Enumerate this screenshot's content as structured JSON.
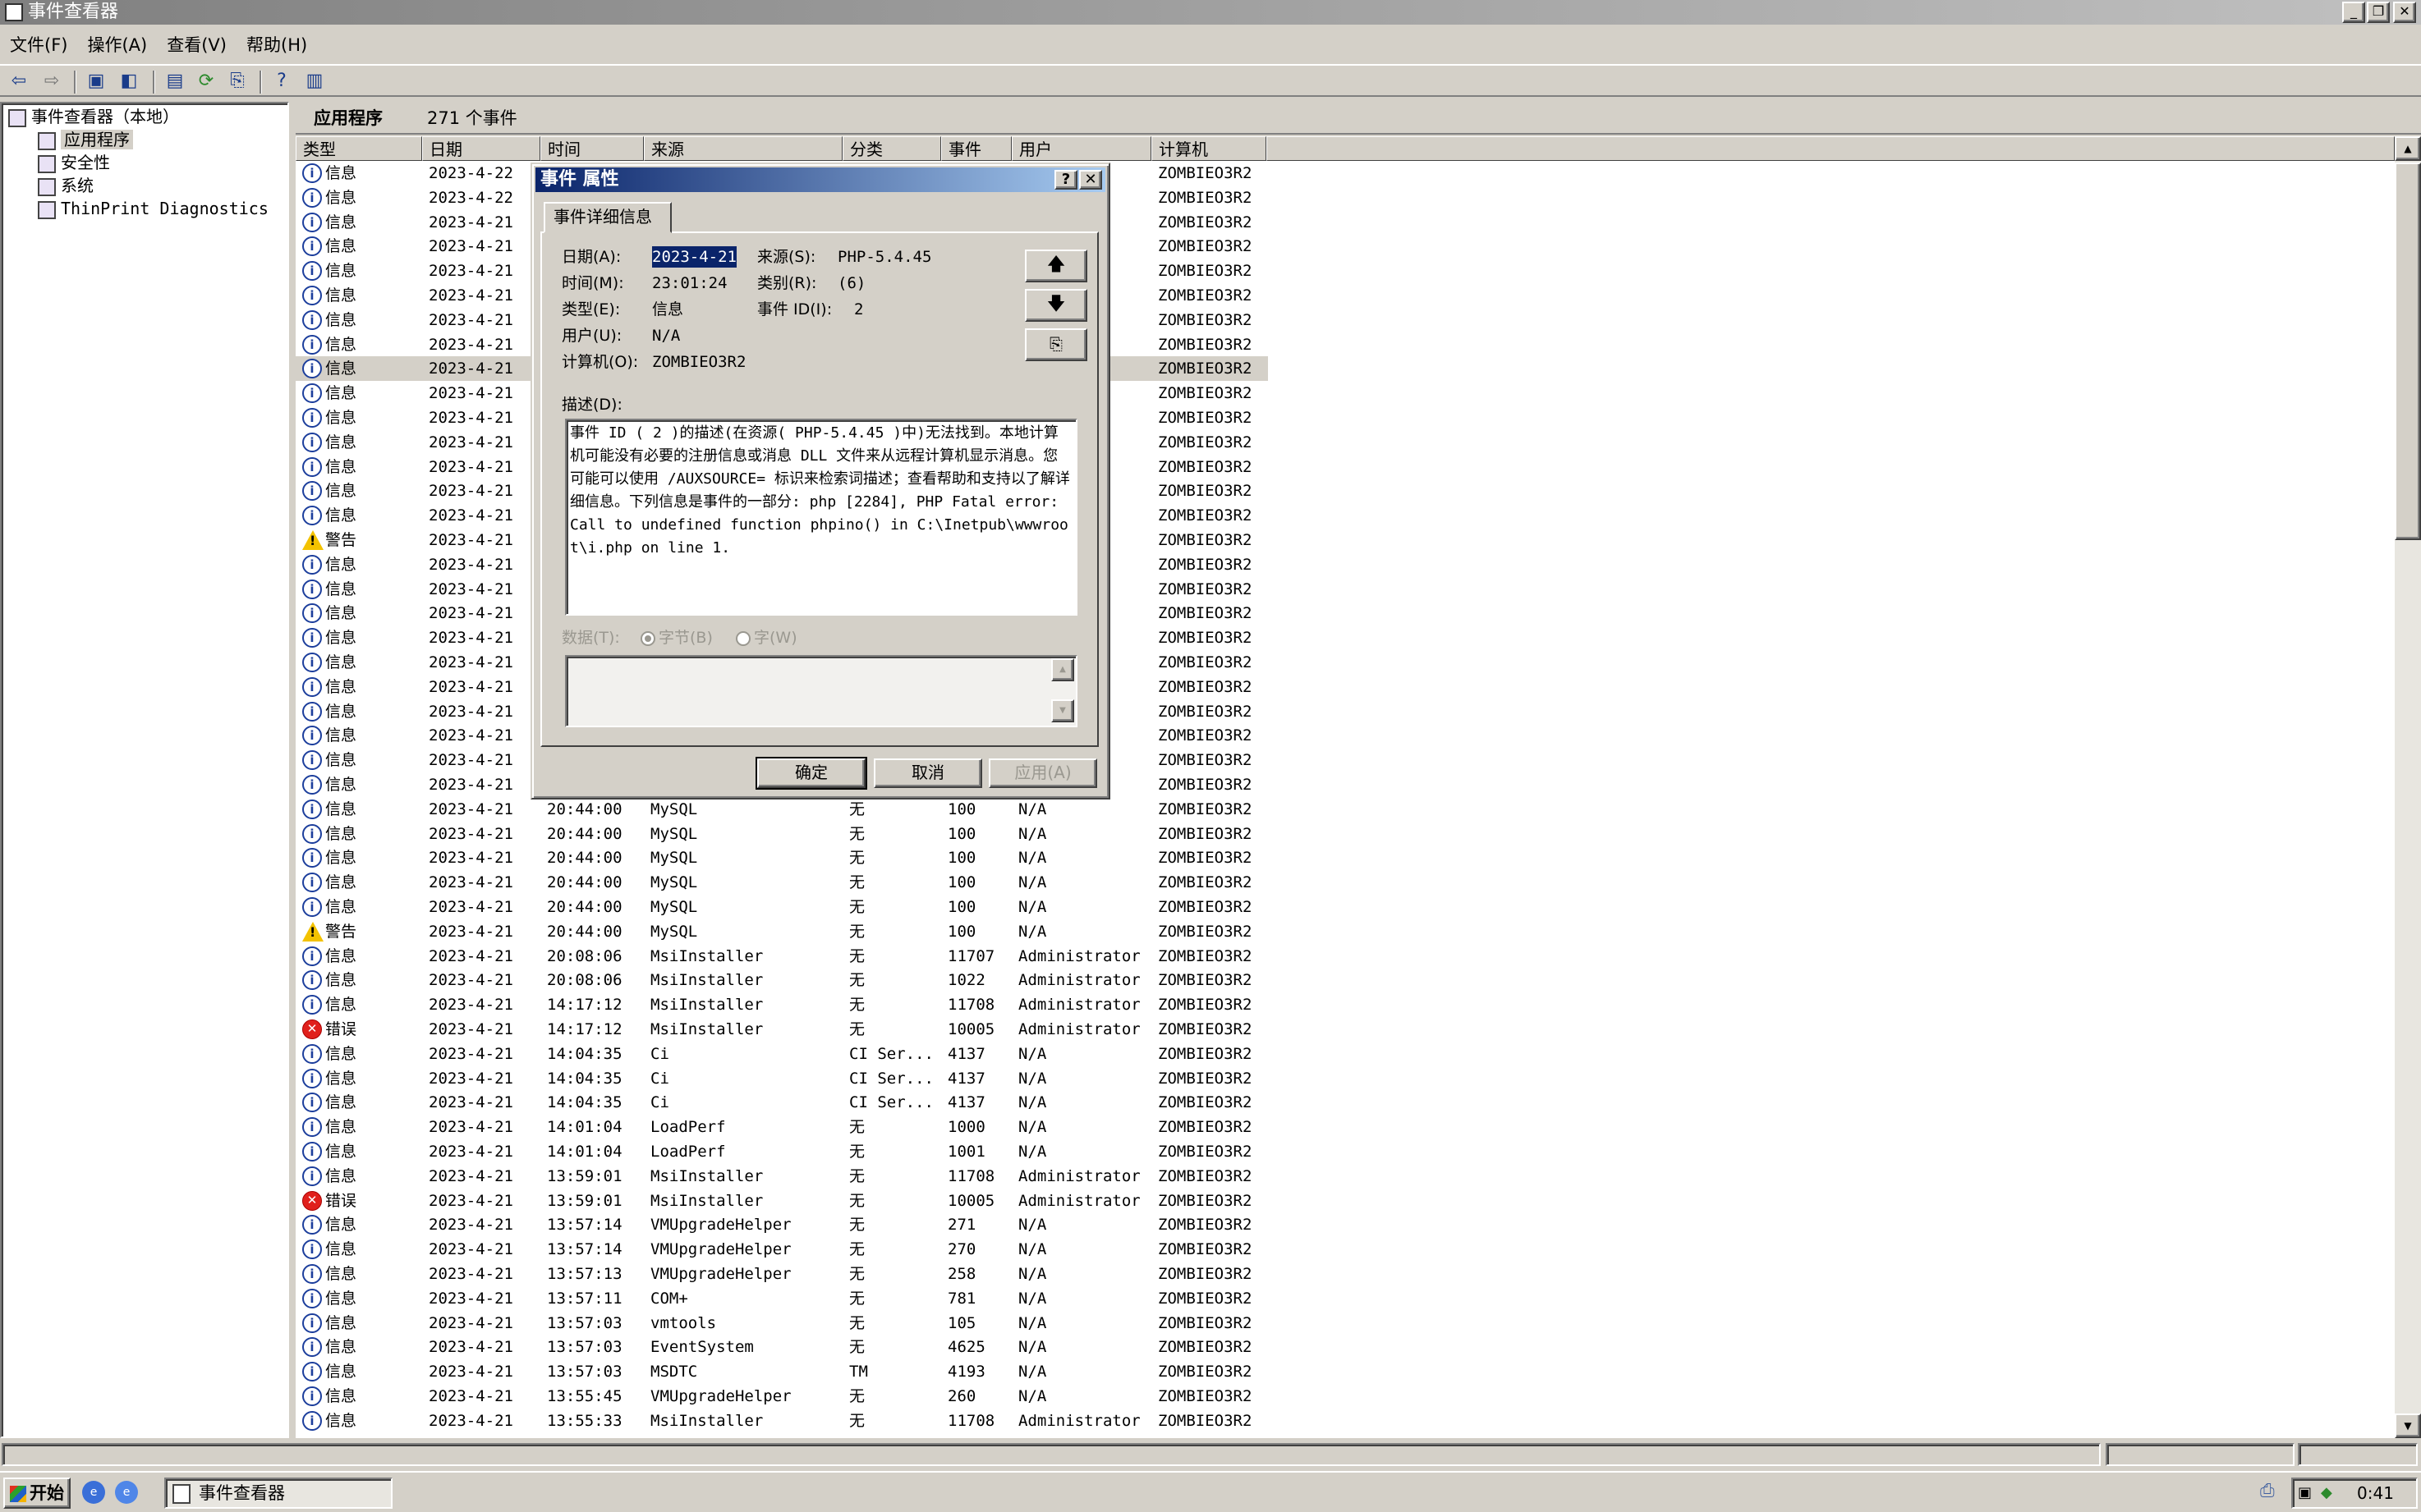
{
  "window": {
    "title": "事件查看器"
  },
  "menu": [
    "文件(F)",
    "操作(A)",
    "查看(V)",
    "帮助(H)"
  ],
  "toolbar_icons": [
    "back-arrow-icon",
    "forward-arrow-icon",
    "up-folder-icon",
    "show-tree-icon",
    "properties-icon",
    "refresh-icon",
    "export-icon",
    "help-icon",
    "console-icon"
  ],
  "tree": {
    "root": "事件查看器（本地）",
    "items": [
      "应用程序",
      "安全性",
      "系统",
      "ThinPrint Diagnostics"
    ],
    "selected": "应用程序"
  },
  "list_header": {
    "title": "应用程序",
    "count": "271 个事件"
  },
  "columns": [
    "类型",
    "日期",
    "时间",
    "来源",
    "分类",
    "事件",
    "用户",
    "计算机"
  ],
  "rows": [
    {
      "icon": "info",
      "type": "信息",
      "date": "2023-4-22",
      "time": "",
      "source": "",
      "category": "",
      "event": "",
      "user": "",
      "computer": "ZOMBIEO3R2"
    },
    {
      "icon": "info",
      "type": "信息",
      "date": "2023-4-22",
      "time": "",
      "source": "",
      "category": "",
      "event": "",
      "user": "",
      "computer": "ZOMBIEO3R2"
    },
    {
      "icon": "info",
      "type": "信息",
      "date": "2023-4-21",
      "time": "",
      "source": "",
      "category": "",
      "event": "",
      "user": "",
      "computer": "ZOMBIEO3R2"
    },
    {
      "icon": "info",
      "type": "信息",
      "date": "2023-4-21",
      "time": "",
      "source": "",
      "category": "",
      "event": "",
      "user": "",
      "computer": "ZOMBIEO3R2"
    },
    {
      "icon": "info",
      "type": "信息",
      "date": "2023-4-21",
      "time": "",
      "source": "",
      "category": "",
      "event": "",
      "user": "",
      "computer": "ZOMBIEO3R2"
    },
    {
      "icon": "info",
      "type": "信息",
      "date": "2023-4-21",
      "time": "",
      "source": "",
      "category": "",
      "event": "",
      "user": "",
      "computer": "ZOMBIEO3R2"
    },
    {
      "icon": "info",
      "type": "信息",
      "date": "2023-4-21",
      "time": "",
      "source": "",
      "category": "",
      "event": "",
      "user": "",
      "computer": "ZOMBIEO3R2"
    },
    {
      "icon": "info",
      "type": "信息",
      "date": "2023-4-21",
      "time": "",
      "source": "",
      "category": "",
      "event": "",
      "user": "",
      "computer": "ZOMBIEO3R2"
    },
    {
      "icon": "info",
      "type": "信息",
      "date": "2023-4-21",
      "time": "",
      "source": "",
      "category": "",
      "event": "",
      "user": "",
      "computer": "ZOMBIEO3R2",
      "selected": true
    },
    {
      "icon": "info",
      "type": "信息",
      "date": "2023-4-21",
      "time": "",
      "source": "",
      "category": "",
      "event": "",
      "user": "",
      "computer": "ZOMBIEO3R2"
    },
    {
      "icon": "info",
      "type": "信息",
      "date": "2023-4-21",
      "time": "",
      "source": "",
      "category": "",
      "event": "",
      "user": "",
      "computer": "ZOMBIEO3R2"
    },
    {
      "icon": "info",
      "type": "信息",
      "date": "2023-4-21",
      "time": "",
      "source": "",
      "category": "",
      "event": "",
      "user": "",
      "computer": "ZOMBIEO3R2"
    },
    {
      "icon": "info",
      "type": "信息",
      "date": "2023-4-21",
      "time": "",
      "source": "",
      "category": "",
      "event": "",
      "user": "",
      "computer": "ZOMBIEO3R2"
    },
    {
      "icon": "info",
      "type": "信息",
      "date": "2023-4-21",
      "time": "",
      "source": "",
      "category": "",
      "event": "",
      "user": "",
      "computer": "ZOMBIEO3R2"
    },
    {
      "icon": "info",
      "type": "信息",
      "date": "2023-4-21",
      "time": "",
      "source": "",
      "category": "",
      "event": "",
      "user": "",
      "computer": "ZOMBIEO3R2"
    },
    {
      "icon": "warn",
      "type": "警告",
      "date": "2023-4-21",
      "time": "",
      "source": "",
      "category": "",
      "event": "",
      "user": "",
      "computer": "ZOMBIEO3R2"
    },
    {
      "icon": "info",
      "type": "信息",
      "date": "2023-4-21",
      "time": "",
      "source": "",
      "category": "",
      "event": "",
      "user": "",
      "computer": "ZOMBIEO3R2"
    },
    {
      "icon": "info",
      "type": "信息",
      "date": "2023-4-21",
      "time": "",
      "source": "",
      "category": "",
      "event": "",
      "user": "",
      "computer": "ZOMBIEO3R2"
    },
    {
      "icon": "info",
      "type": "信息",
      "date": "2023-4-21",
      "time": "",
      "source": "",
      "category": "",
      "event": "",
      "user": "",
      "computer": "ZOMBIEO3R2"
    },
    {
      "icon": "info",
      "type": "信息",
      "date": "2023-4-21",
      "time": "",
      "source": "",
      "category": "",
      "event": "",
      "user": "",
      "computer": "ZOMBIEO3R2"
    },
    {
      "icon": "info",
      "type": "信息",
      "date": "2023-4-21",
      "time": "",
      "source": "",
      "category": "",
      "event": "",
      "user": "",
      "computer": "ZOMBIEO3R2"
    },
    {
      "icon": "info",
      "type": "信息",
      "date": "2023-4-21",
      "time": "",
      "source": "",
      "category": "",
      "event": "",
      "user": "",
      "computer": "ZOMBIEO3R2"
    },
    {
      "icon": "info",
      "type": "信息",
      "date": "2023-4-21",
      "time": "",
      "source": "",
      "category": "",
      "event": "",
      "user": "",
      "computer": "ZOMBIEO3R2"
    },
    {
      "icon": "info",
      "type": "信息",
      "date": "2023-4-21",
      "time": "",
      "source": "",
      "category": "",
      "event": "",
      "user": "",
      "computer": "ZOMBIEO3R2"
    },
    {
      "icon": "info",
      "type": "信息",
      "date": "2023-4-21",
      "time": "",
      "source": "",
      "category": "",
      "event": "",
      "user": "",
      "computer": "ZOMBIEO3R2"
    },
    {
      "icon": "info",
      "type": "信息",
      "date": "2023-4-21",
      "time": "",
      "source": "",
      "category": "",
      "event": "",
      "user": "",
      "computer": "ZOMBIEO3R2"
    },
    {
      "icon": "info",
      "type": "信息",
      "date": "2023-4-21",
      "time": "20:44:00",
      "source": "MySQL",
      "category": "无",
      "event": "100",
      "user": "N/A",
      "computer": "ZOMBIEO3R2"
    },
    {
      "icon": "info",
      "type": "信息",
      "date": "2023-4-21",
      "time": "20:44:00",
      "source": "MySQL",
      "category": "无",
      "event": "100",
      "user": "N/A",
      "computer": "ZOMBIEO3R2"
    },
    {
      "icon": "info",
      "type": "信息",
      "date": "2023-4-21",
      "time": "20:44:00",
      "source": "MySQL",
      "category": "无",
      "event": "100",
      "user": "N/A",
      "computer": "ZOMBIEO3R2"
    },
    {
      "icon": "info",
      "type": "信息",
      "date": "2023-4-21",
      "time": "20:44:00",
      "source": "MySQL",
      "category": "无",
      "event": "100",
      "user": "N/A",
      "computer": "ZOMBIEO3R2"
    },
    {
      "icon": "info",
      "type": "信息",
      "date": "2023-4-21",
      "time": "20:44:00",
      "source": "MySQL",
      "category": "无",
      "event": "100",
      "user": "N/A",
      "computer": "ZOMBIEO3R2"
    },
    {
      "icon": "warn",
      "type": "警告",
      "date": "2023-4-21",
      "time": "20:44:00",
      "source": "MySQL",
      "category": "无",
      "event": "100",
      "user": "N/A",
      "computer": "ZOMBIEO3R2"
    },
    {
      "icon": "info",
      "type": "信息",
      "date": "2023-4-21",
      "time": "20:08:06",
      "source": "MsiInstaller",
      "category": "无",
      "event": "11707",
      "user": "Administrator",
      "computer": "ZOMBIEO3R2"
    },
    {
      "icon": "info",
      "type": "信息",
      "date": "2023-4-21",
      "time": "20:08:06",
      "source": "MsiInstaller",
      "category": "无",
      "event": "1022",
      "user": "Administrator",
      "computer": "ZOMBIEO3R2"
    },
    {
      "icon": "info",
      "type": "信息",
      "date": "2023-4-21",
      "time": "14:17:12",
      "source": "MsiInstaller",
      "category": "无",
      "event": "11708",
      "user": "Administrator",
      "computer": "ZOMBIEO3R2"
    },
    {
      "icon": "err",
      "type": "错误",
      "date": "2023-4-21",
      "time": "14:17:12",
      "source": "MsiInstaller",
      "category": "无",
      "event": "10005",
      "user": "Administrator",
      "computer": "ZOMBIEO3R2"
    },
    {
      "icon": "info",
      "type": "信息",
      "date": "2023-4-21",
      "time": "14:04:35",
      "source": "Ci",
      "category": "CI Ser...",
      "event": "4137",
      "user": "N/A",
      "computer": "ZOMBIEO3R2"
    },
    {
      "icon": "info",
      "type": "信息",
      "date": "2023-4-21",
      "time": "14:04:35",
      "source": "Ci",
      "category": "CI Ser...",
      "event": "4137",
      "user": "N/A",
      "computer": "ZOMBIEO3R2"
    },
    {
      "icon": "info",
      "type": "信息",
      "date": "2023-4-21",
      "time": "14:04:35",
      "source": "Ci",
      "category": "CI Ser...",
      "event": "4137",
      "user": "N/A",
      "computer": "ZOMBIEO3R2"
    },
    {
      "icon": "info",
      "type": "信息",
      "date": "2023-4-21",
      "time": "14:01:04",
      "source": "LoadPerf",
      "category": "无",
      "event": "1000",
      "user": "N/A",
      "computer": "ZOMBIEO3R2"
    },
    {
      "icon": "info",
      "type": "信息",
      "date": "2023-4-21",
      "time": "14:01:04",
      "source": "LoadPerf",
      "category": "无",
      "event": "1001",
      "user": "N/A",
      "computer": "ZOMBIEO3R2"
    },
    {
      "icon": "info",
      "type": "信息",
      "date": "2023-4-21",
      "time": "13:59:01",
      "source": "MsiInstaller",
      "category": "无",
      "event": "11708",
      "user": "Administrator",
      "computer": "ZOMBIEO3R2"
    },
    {
      "icon": "err",
      "type": "错误",
      "date": "2023-4-21",
      "time": "13:59:01",
      "source": "MsiInstaller",
      "category": "无",
      "event": "10005",
      "user": "Administrator",
      "computer": "ZOMBIEO3R2"
    },
    {
      "icon": "info",
      "type": "信息",
      "date": "2023-4-21",
      "time": "13:57:14",
      "source": "VMUpgradeHelper",
      "category": "无",
      "event": "271",
      "user": "N/A",
      "computer": "ZOMBIEO3R2"
    },
    {
      "icon": "info",
      "type": "信息",
      "date": "2023-4-21",
      "time": "13:57:14",
      "source": "VMUpgradeHelper",
      "category": "无",
      "event": "270",
      "user": "N/A",
      "computer": "ZOMBIEO3R2"
    },
    {
      "icon": "info",
      "type": "信息",
      "date": "2023-4-21",
      "time": "13:57:13",
      "source": "VMUpgradeHelper",
      "category": "无",
      "event": "258",
      "user": "N/A",
      "computer": "ZOMBIEO3R2"
    },
    {
      "icon": "info",
      "type": "信息",
      "date": "2023-4-21",
      "time": "13:57:11",
      "source": "COM+",
      "category": "无",
      "event": "781",
      "user": "N/A",
      "computer": "ZOMBIEO3R2"
    },
    {
      "icon": "info",
      "type": "信息",
      "date": "2023-4-21",
      "time": "13:57:03",
      "source": "vmtools",
      "category": "无",
      "event": "105",
      "user": "N/A",
      "computer": "ZOMBIEO3R2"
    },
    {
      "icon": "info",
      "type": "信息",
      "date": "2023-4-21",
      "time": "13:57:03",
      "source": "EventSystem",
      "category": "无",
      "event": "4625",
      "user": "N/A",
      "computer": "ZOMBIEO3R2"
    },
    {
      "icon": "info",
      "type": "信息",
      "date": "2023-4-21",
      "time": "13:57:03",
      "source": "MSDTC",
      "category": "TM",
      "event": "4193",
      "user": "N/A",
      "computer": "ZOMBIEO3R2"
    },
    {
      "icon": "info",
      "type": "信息",
      "date": "2023-4-21",
      "time": "13:55:45",
      "source": "VMUpgradeHelper",
      "category": "无",
      "event": "260",
      "user": "N/A",
      "computer": "ZOMBIEO3R2"
    },
    {
      "icon": "info",
      "type": "信息",
      "date": "2023-4-21",
      "time": "13:55:33",
      "source": "MsiInstaller",
      "category": "无",
      "event": "11708",
      "user": "Administrator",
      "computer": "ZOMBIEO3R2"
    }
  ],
  "dialog": {
    "title": "事件 属性",
    "help_glyph": "?",
    "close_glyph": "✕",
    "tab": "事件详细信息",
    "date_label": "日期(A):",
    "date_value": "2023-4-21",
    "source_label": "来源(S):",
    "source_value": "PHP-5.4.45",
    "time_label": "时间(M):",
    "time_value": "23:01:24",
    "category_label": "类别(R):",
    "category_value": "(6)",
    "type_label": "类型(E):",
    "type_value": "信息",
    "event_id_label": "事件 ID(I):",
    "event_id_value": "2",
    "user_label": "用户(U):",
    "user_value": "N/A",
    "computer_label": "计算机(O):",
    "computer_value": "ZOMBIEO3R2",
    "desc_label": "描述(D):",
    "description": "事件 ID ( 2 )的描述(在资源( PHP-5.4.45 )中)无法找到。本地计算机可能没有必要的注册信息或消息 DLL 文件来从远程计算机显示消息。您可能可以使用 /AUXSOURCE= 标识来检索词描述；查看帮助和支持以了解详细信息。下列信息是事件的一部分: php [2284], PHP Fatal error:  Call to undefined function phpino() in C:\\Inetpub\\wwwroot\\i.php on line 1.",
    "data_label": "数据(T):",
    "radio_bytes": "字节(B)",
    "radio_words": "字(W)",
    "ok": "确定",
    "cancel": "取消",
    "apply": "应用(A)"
  },
  "taskbar": {
    "start": "开始",
    "task": "事件查看器",
    "clock": "0:41"
  }
}
